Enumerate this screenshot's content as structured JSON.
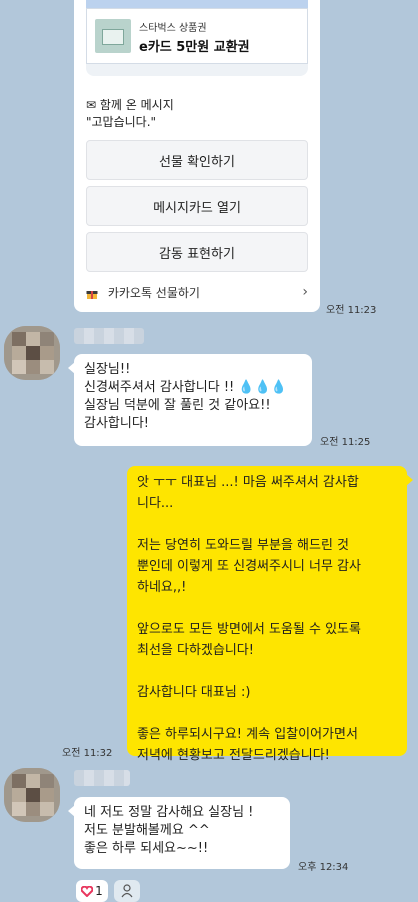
{
  "gift_card": {
    "brand": "스타벅스 상품권",
    "product": "e카드 5만원 교환권",
    "message_title": "✉ 함께 온 메시지",
    "message_text": "\"고맙습니다.\"",
    "buttons": [
      "선물 확인하기",
      "메시지카드 열기",
      "감동 표현하기"
    ],
    "footer_label": "카카오톡 선물하기",
    "footer_chevron": "›",
    "time": "오전 11:23"
  },
  "messages": [
    {
      "lines": [
        "실장님!!",
        "신경써주셔서 감사합니다 !! 💧💧💧",
        "실장님 덕분에 잘 풀린 것 같아요!!",
        "감사합니다!"
      ],
      "time": "오전 11:25"
    },
    {
      "lines": [
        "앗 ㅜㅜ 대표님 ...! 마음 써주셔서 감사합",
        "니다...",
        "",
        "저는 당연히 도와드릴 부분을 해드린 것",
        "뿐인데 이렇게 또 신경써주시니 너무 감사",
        "하네요,,!",
        "",
        "앞으로도 모든 방면에서 도움될 수 있도록",
        "최선을 다하겠습니다!",
        "",
        "감사합니다 대표님 :)",
        "",
        "좋은 하루되시구요! 계속 입찰이어가면서",
        "저녁에 현황보고 전달드리겠습니다!"
      ],
      "time": "오전 11:32"
    },
    {
      "lines": [
        "네 저도 정말 감사해요 실장님 !",
        "저도 분발해볼께요 ^^",
        "좋은 하루 되세요~~!!"
      ],
      "time": "오후 12:34"
    }
  ],
  "reaction": {
    "count": "1"
  },
  "colors": {
    "background": "#b2c7da",
    "my_bubble": "#fee500",
    "other_bubble": "#ffffff",
    "heart": "#e8365d"
  }
}
